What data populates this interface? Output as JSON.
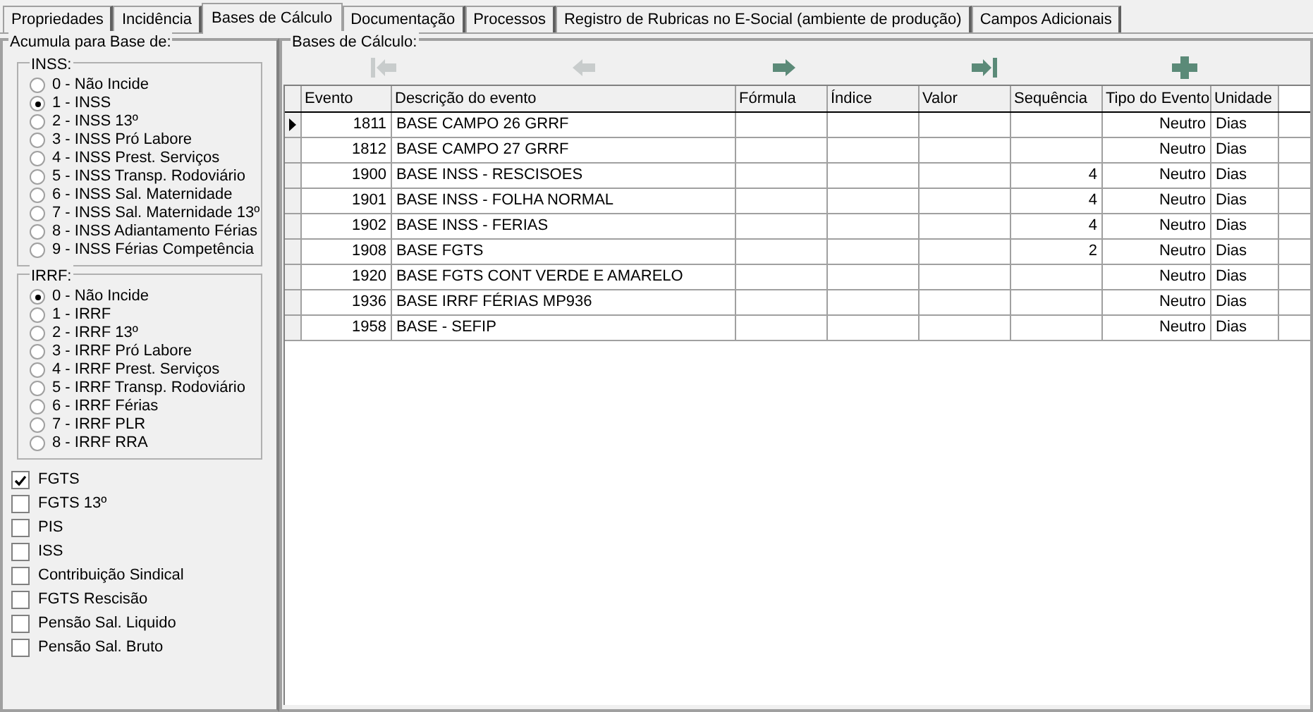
{
  "tabs": [
    {
      "label": "Propriedades",
      "selected": false
    },
    {
      "label": "Incidência",
      "selected": false
    },
    {
      "label": "Bases de Cálculo",
      "selected": true
    },
    {
      "label": "Documentação",
      "selected": false
    },
    {
      "label": "Processos",
      "selected": false
    },
    {
      "label": "Registro de Rubricas no E-Social (ambiente de produção)",
      "selected": false
    },
    {
      "label": "Campos Adicionais",
      "selected": false
    }
  ],
  "left_panel": {
    "title": "Acumula para Base de:",
    "groups": [
      {
        "title": "INSS:",
        "options": [
          {
            "label": "0 - Não Incide",
            "selected": false
          },
          {
            "label": "1 - INSS",
            "selected": true
          },
          {
            "label": "2 - INSS 13º",
            "selected": false
          },
          {
            "label": "3 - INSS Pró Labore",
            "selected": false
          },
          {
            "label": "4 - INSS Prest. Serviços",
            "selected": false
          },
          {
            "label": "5 - INSS Transp. Rodoviário",
            "selected": false
          },
          {
            "label": "6 - INSS Sal. Maternidade",
            "selected": false
          },
          {
            "label": "7 - INSS Sal. Maternidade 13º",
            "selected": false
          },
          {
            "label": "8 - INSS Adiantamento Férias",
            "selected": false
          },
          {
            "label": "9 - INSS Férias Competência",
            "selected": false
          }
        ]
      },
      {
        "title": "IRRF:",
        "options": [
          {
            "label": "0 - Não Incide",
            "selected": true
          },
          {
            "label": "1 - IRRF",
            "selected": false
          },
          {
            "label": "2 - IRRF 13º",
            "selected": false
          },
          {
            "label": "3 - IRRF Pró Labore",
            "selected": false
          },
          {
            "label": "4 - IRRF Prest. Serviços",
            "selected": false
          },
          {
            "label": "5 - IRRF Transp. Rodoviário",
            "selected": false
          },
          {
            "label": "6 - IRRF Férias",
            "selected": false
          },
          {
            "label": "7 - IRRF PLR",
            "selected": false
          },
          {
            "label": "8 - IRRF RRA",
            "selected": false
          }
        ]
      }
    ],
    "checkboxes": [
      {
        "label": "FGTS",
        "checked": true
      },
      {
        "label": "FGTS 13º",
        "checked": false
      },
      {
        "label": "PIS",
        "checked": false
      },
      {
        "label": "ISS",
        "checked": false
      },
      {
        "label": "Contribuição Sindical",
        "checked": false
      },
      {
        "label": "FGTS Rescisão",
        "checked": false
      },
      {
        "label": "Pensão Sal. Liquido",
        "checked": false
      },
      {
        "label": "Pensão Sal. Bruto",
        "checked": false
      }
    ]
  },
  "right_panel": {
    "title": "Bases de Cálculo:",
    "toolbar": [
      {
        "kind": "first",
        "disabled": true
      },
      {
        "kind": "prev",
        "disabled": true
      },
      {
        "kind": "next",
        "disabled": false
      },
      {
        "kind": "last",
        "disabled": false
      },
      {
        "kind": "add",
        "disabled": false
      }
    ],
    "table": {
      "columns": [
        "Evento",
        "Descrição do evento",
        "Fórmula",
        "Índice",
        "Valor",
        "Sequência",
        "Tipo do Evento",
        "Unidade"
      ],
      "rows": [
        {
          "current": true,
          "cells": [
            "1811",
            "BASE CAMPO 26 GRRF",
            "",
            "",
            "",
            "",
            "Neutro",
            "Dias"
          ]
        },
        {
          "current": false,
          "cells": [
            "1812",
            "BASE CAMPO 27 GRRF",
            "",
            "",
            "",
            "",
            "Neutro",
            "Dias"
          ]
        },
        {
          "current": false,
          "cells": [
            "1900",
            "BASE INSS - RESCISOES",
            "",
            "",
            "",
            "4",
            "Neutro",
            "Dias"
          ]
        },
        {
          "current": false,
          "cells": [
            "1901",
            "BASE INSS - FOLHA NORMAL",
            "",
            "",
            "",
            "4",
            "Neutro",
            "Dias"
          ]
        },
        {
          "current": false,
          "cells": [
            "1902",
            "BASE INSS - FERIAS",
            "",
            "",
            "",
            "4",
            "Neutro",
            "Dias"
          ]
        },
        {
          "current": false,
          "cells": [
            "1908",
            "BASE FGTS",
            "",
            "",
            "",
            "2",
            "Neutro",
            "Dias"
          ]
        },
        {
          "current": false,
          "cells": [
            "1920",
            "BASE FGTS CONT VERDE E AMARELO",
            "",
            "",
            "",
            "",
            "Neutro",
            "Dias"
          ]
        },
        {
          "current": false,
          "cells": [
            "1936",
            "BASE IRRF FÉRIAS MP936",
            "",
            "",
            "",
            "",
            "Neutro",
            "Dias"
          ]
        },
        {
          "current": false,
          "cells": [
            "1958",
            "BASE - SEFIP",
            "",
            "",
            "",
            "",
            "Neutro",
            "Dias"
          ]
        }
      ]
    }
  }
}
